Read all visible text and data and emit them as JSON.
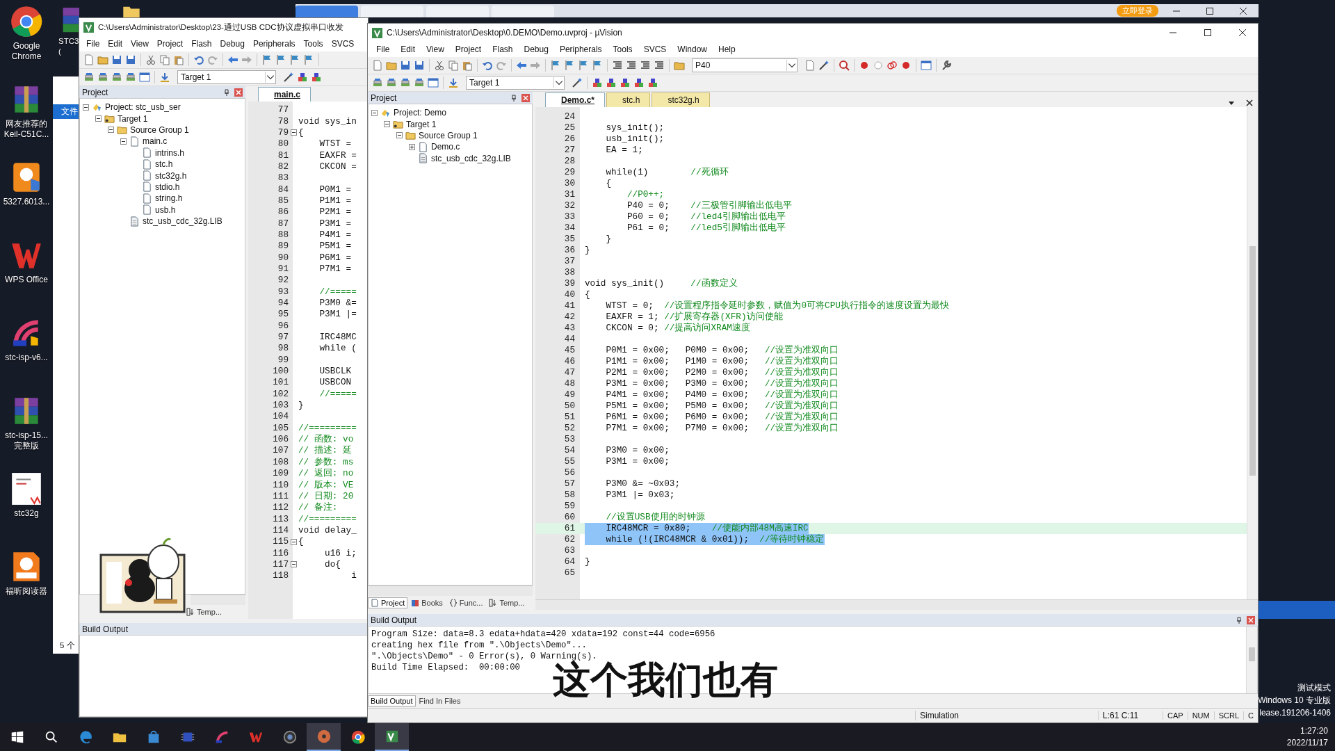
{
  "desktop": {
    "icons": [
      {
        "kind": "chrome",
        "label": [
          "Google",
          "Chrome"
        ]
      },
      {
        "kind": "archive",
        "label": [
          "网友推荐的",
          "Keil-C51C..."
        ]
      },
      {
        "kind": "pdf",
        "label": [
          "5327.6013..."
        ]
      },
      {
        "kind": "wps",
        "label": [
          "WPS Office"
        ]
      },
      {
        "kind": "isp",
        "label": [
          "stc-isp-v6..."
        ]
      },
      {
        "kind": "archive",
        "label": [
          "stc-isp-15...",
          "完整版"
        ]
      },
      {
        "kind": "doc",
        "label": [
          "stc32g"
        ]
      },
      {
        "kind": "foxit",
        "label": [
          "福昕阅读器"
        ]
      }
    ],
    "partial_icon": {
      "label": [
        "STC3",
        "("
      ]
    }
  },
  "browser_strip": {
    "tabs": [
      {
        "selected": true
      },
      {
        "selected": false
      },
      {
        "selected": false
      },
      {
        "selected": false
      }
    ],
    "login_button": "立即登录"
  },
  "explorer_window": {
    "ribbon_tab": "文件",
    "status": "5 个"
  },
  "back_window": {
    "title": "C:\\Users\\Administrator\\Desktop\\23-通过USB CDC协议虚拟串口收发",
    "menu": [
      "File",
      "Edit",
      "View",
      "Project",
      "Flash",
      "Debug",
      "Peripherals",
      "Tools",
      "SVCS"
    ],
    "target": "Target 1",
    "project_panel": {
      "title": "Project",
      "tree": [
        {
          "kind": "project",
          "label": "Project: stc_usb_ser",
          "expanded": true,
          "children": [
            {
              "kind": "target",
              "label": "Target 1",
              "expanded": true,
              "children": [
                {
                  "kind": "group",
                  "label": "Source Group 1",
                  "expanded": true,
                  "children": [
                    {
                      "kind": "file",
                      "label": "main.c",
                      "expanded": true,
                      "children": [
                        {
                          "kind": "file",
                          "label": "intrins.h"
                        },
                        {
                          "kind": "file",
                          "label": "stc.h"
                        },
                        {
                          "kind": "file",
                          "label": "stc32g.h"
                        },
                        {
                          "kind": "file",
                          "label": "stdio.h"
                        },
                        {
                          "kind": "file",
                          "label": "string.h"
                        },
                        {
                          "kind": "file",
                          "label": "usb.h"
                        }
                      ]
                    },
                    {
                      "kind": "lib",
                      "label": "stc_usb_cdc_32g.LIB"
                    }
                  ]
                }
              ]
            }
          ]
        }
      ],
      "tabs": [
        {
          "kind": "templates",
          "label": "Temp...",
          "selected": false
        }
      ]
    },
    "editor": {
      "tabs": [
        {
          "label": "main.c",
          "selected": true
        }
      ],
      "lines": [
        {
          "n": "77"
        },
        {
          "n": "78",
          "code": "void sys_in"
        },
        {
          "n": "79",
          "code": "{",
          "fold": true
        },
        {
          "n": "80",
          "code": "    WTST ="
        },
        {
          "n": "81",
          "code": "    EAXFR ="
        },
        {
          "n": "82",
          "code": "    CKCON ="
        },
        {
          "n": "83"
        },
        {
          "n": "84",
          "code": "    P0M1 ="
        },
        {
          "n": "85",
          "code": "    P1M1 ="
        },
        {
          "n": "86",
          "code": "    P2M1 ="
        },
        {
          "n": "87",
          "code": "    P3M1 ="
        },
        {
          "n": "88",
          "code": "    P4M1 ="
        },
        {
          "n": "89",
          "code": "    P5M1 ="
        },
        {
          "n": "90",
          "code": "    P6M1 ="
        },
        {
          "n": "91",
          "code": "    P7M1 ="
        },
        {
          "n": "92"
        },
        {
          "n": "93",
          "comment": "    //====="
        },
        {
          "n": "94",
          "code": "    P3M0 &="
        },
        {
          "n": "95",
          "code": "    P3M1 |="
        },
        {
          "n": "96"
        },
        {
          "n": "97",
          "code": "    IRC48MC"
        },
        {
          "n": "98",
          "code": "    while ("
        },
        {
          "n": "99"
        },
        {
          "n": "100",
          "code": "    USBCLK"
        },
        {
          "n": "101",
          "code": "    USBCON"
        },
        {
          "n": "102",
          "comment": "    //====="
        },
        {
          "n": "103",
          "code": "}"
        },
        {
          "n": "104"
        },
        {
          "n": "105",
          "comment": "//========="
        },
        {
          "n": "106",
          "comment": "// 函数: vo"
        },
        {
          "n": "107",
          "comment": "// 描述: 延"
        },
        {
          "n": "108",
          "comment": "// 参数: ms"
        },
        {
          "n": "109",
          "comment": "// 返回: no"
        },
        {
          "n": "110",
          "comment": "// 版本: VE"
        },
        {
          "n": "111",
          "comment": "// 日期: 20"
        },
        {
          "n": "112",
          "comment": "// 备注:"
        },
        {
          "n": "113",
          "comment": "//========="
        },
        {
          "n": "114",
          "code": "void delay_"
        },
        {
          "n": "115",
          "code": "{",
          "fold": true
        },
        {
          "n": "116",
          "code": "     u16 i;"
        },
        {
          "n": "117",
          "code": "     do{",
          "fold": true
        },
        {
          "n": "118",
          "code": "          i"
        }
      ]
    },
    "build_output": {
      "title": "Build Output"
    }
  },
  "front_window": {
    "title": "C:\\Users\\Administrator\\Desktop\\0.DEMO\\Demo.uvproj - µVision",
    "menu": [
      "File",
      "Edit",
      "View",
      "Project",
      "Flash",
      "Debug",
      "Peripherals",
      "Tools",
      "SVCS",
      "Window",
      "Help"
    ],
    "find_value": "P40",
    "target": "Target 1",
    "project_panel": {
      "title": "Project",
      "tree": [
        {
          "kind": "project",
          "label": "Project: Demo",
          "expanded": true,
          "children": [
            {
              "kind": "target",
              "label": "Target 1",
              "expanded": true,
              "children": [
                {
                  "kind": "group",
                  "label": "Source Group 1",
                  "expanded": true,
                  "children": [
                    {
                      "kind": "file",
                      "label": "Demo.c",
                      "expanded": false
                    },
                    {
                      "kind": "lib",
                      "label": "stc_usb_cdc_32g.LIB"
                    }
                  ]
                }
              ]
            }
          ]
        }
      ],
      "tabs": [
        {
          "kind": "project",
          "label": "Project",
          "selected": true
        },
        {
          "kind": "books",
          "label": "Books",
          "selected": false
        },
        {
          "kind": "functions",
          "label": "Func...",
          "selected": false
        },
        {
          "kind": "templates",
          "label": "Temp...",
          "selected": false
        }
      ]
    },
    "editor": {
      "tabs": [
        {
          "label": "Demo.c*",
          "selected": true
        },
        {
          "label": "stc.h",
          "selected": false
        },
        {
          "label": "stc32g.h",
          "selected": false
        }
      ],
      "lines": [
        {
          "n": "24"
        },
        {
          "n": "25",
          "code": "    sys_init();"
        },
        {
          "n": "26",
          "code": "    usb_init();"
        },
        {
          "n": "27",
          "code": "    EA = 1;"
        },
        {
          "n": "28"
        },
        {
          "n": "29",
          "code": "    while(1)        ",
          "comment": "//死循环"
        },
        {
          "n": "30",
          "code": "    {"
        },
        {
          "n": "31",
          "comment": "        //P0++;"
        },
        {
          "n": "32",
          "code": "        P40 = 0;    ",
          "comment": "//三极管引脚输出低电平"
        },
        {
          "n": "33",
          "code": "        P60 = 0;    ",
          "comment": "//led4引脚输出低电平"
        },
        {
          "n": "34",
          "code": "        P61 = 0;    ",
          "comment": "//led5引脚输出低电平"
        },
        {
          "n": "35",
          "code": "    }"
        },
        {
          "n": "36",
          "code": "}"
        },
        {
          "n": "37"
        },
        {
          "n": "38"
        },
        {
          "n": "39",
          "code": "void sys_init()     ",
          "comment": "//函数定义"
        },
        {
          "n": "40",
          "code": "{"
        },
        {
          "n": "41",
          "code": "    WTST = 0;  ",
          "comment": "//设置程序指令延时参数，赋值为0可将CPU执行指令的速度设置为最快"
        },
        {
          "n": "42",
          "code": "    EAXFR = 1; ",
          "comment": "//扩展寄存器(XFR)访问使能"
        },
        {
          "n": "43",
          "code": "    CKCON = 0; ",
          "comment": "//提高访问XRAM速度"
        },
        {
          "n": "44"
        },
        {
          "n": "45",
          "code": "    P0M1 = 0x00;   P0M0 = 0x00;   ",
          "comment": "//设置为准双向口"
        },
        {
          "n": "46",
          "code": "    P1M1 = 0x00;   P1M0 = 0x00;   ",
          "comment": "//设置为准双向口"
        },
        {
          "n": "47",
          "code": "    P2M1 = 0x00;   P2M0 = 0x00;   ",
          "comment": "//设置为准双向口"
        },
        {
          "n": "48",
          "code": "    P3M1 = 0x00;   P3M0 = 0x00;   ",
          "comment": "//设置为准双向口"
        },
        {
          "n": "49",
          "code": "    P4M1 = 0x00;   P4M0 = 0x00;   ",
          "comment": "//设置为准双向口"
        },
        {
          "n": "50",
          "code": "    P5M1 = 0x00;   P5M0 = 0x00;   ",
          "comment": "//设置为准双向口"
        },
        {
          "n": "51",
          "code": "    P6M1 = 0x00;   P6M0 = 0x00;   ",
          "comment": "//设置为准双向口"
        },
        {
          "n": "52",
          "code": "    P7M1 = 0x00;   P7M0 = 0x00;   ",
          "comment": "//设置为准双向口"
        },
        {
          "n": "53"
        },
        {
          "n": "54",
          "code": "    P3M0 = 0x00;"
        },
        {
          "n": "55",
          "code": "    P3M1 = 0x00;"
        },
        {
          "n": "56"
        },
        {
          "n": "57",
          "code": "    P3M0 &= ~0x03;"
        },
        {
          "n": "58",
          "code": "    P3M1 |= 0x03;"
        },
        {
          "n": "59"
        },
        {
          "n": "60",
          "comment": "    //设置USB使用的时钟源"
        },
        {
          "n": "61",
          "code": "    IRC48MCR = 0x80;    ",
          "comment": "//使能内部48M高速IRC",
          "selected": true,
          "current": true
        },
        {
          "n": "62",
          "code": "    while (!(IRC48MCR & 0x01));  ",
          "comment": "//等待时钟稳定",
          "selected": true,
          "current": false
        },
        {
          "n": "63"
        },
        {
          "n": "64",
          "code": "}"
        },
        {
          "n": "65"
        }
      ]
    },
    "build_output": {
      "title": "Build Output",
      "lines": [
        "Program Size: data=8.3 edata+hdata=420 xdata=192 const=44 code=6956",
        "creating hex file from \".\\Objects\\Demo\"...",
        "\".\\Objects\\Demo\" - 0 Error(s), 0 Warning(s).",
        "Build Time Elapsed:  00:00:00"
      ],
      "tabs": [
        {
          "label": "Build Output",
          "selected": true
        },
        {
          "label": "Find In Files",
          "selected": false
        }
      ]
    },
    "status_bar": {
      "mode": "Simulation",
      "position": "L:61 C:11",
      "indicators": [
        "CAP",
        "NUM",
        "SCRL",
        "C"
      ]
    }
  },
  "subtitle": "这个我们也有",
  "system_info": [
    "测试模式",
    "Windows 10 专业版",
    "lease.191206-1406"
  ],
  "taskbar": {
    "apps": [
      {
        "kind": "start",
        "selected": false
      },
      {
        "kind": "search",
        "selected": false
      },
      {
        "kind": "edge",
        "selected": false
      },
      {
        "kind": "explorer",
        "selected": false
      },
      {
        "kind": "store",
        "selected": false
      },
      {
        "kind": "chip",
        "selected": false
      },
      {
        "kind": "isp",
        "selected": false
      },
      {
        "kind": "wps",
        "selected": false
      },
      {
        "kind": "lens",
        "selected": false
      },
      {
        "kind": "media",
        "selected": true
      },
      {
        "kind": "chrome",
        "selected": false
      },
      {
        "kind": "keil",
        "selected": true
      }
    ],
    "time": "1:27:20",
    "date": "2022/11/17"
  }
}
